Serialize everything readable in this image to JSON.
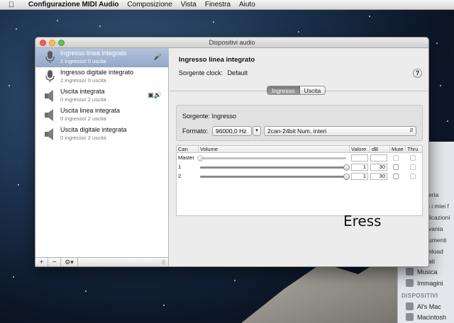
{
  "menubar": {
    "app_name": "Configurazione MIDI Audio",
    "items": [
      "Composizione",
      "Vista",
      "Finestra",
      "Aiuto"
    ],
    "apple_icon": "apple-logo-icon"
  },
  "finder_sidebar": {
    "partial_items": [
      "eria",
      "i i miei f",
      "licazioni",
      "vania",
      "umenti",
      "nload",
      "ati"
    ],
    "items": [
      {
        "label": "Musica",
        "icon": "music-icon"
      },
      {
        "label": "Immagini",
        "icon": "camera-icon"
      }
    ],
    "section_header": "DISPOSITIVI",
    "devices": [
      {
        "label": "Al's Mac",
        "icon": "computer-icon"
      },
      {
        "label": "Macintosh",
        "icon": "drive-icon"
      }
    ]
  },
  "window": {
    "title": "Dispositivi audio"
  },
  "devices": [
    {
      "name": "Ingresso linea integrato",
      "channels": "2 ingresso/ 0 uscita",
      "icon": "microphone-icon",
      "selected": true,
      "right_icon": "microphone-small-icon"
    },
    {
      "name": "Ingresso digitale integrato",
      "channels": "2 ingresso/ 0 uscita",
      "icon": "microphone-icon",
      "selected": false
    },
    {
      "name": "Uscita integrata",
      "channels": "0 ingresso/ 2 uscita",
      "icon": "speaker-icon",
      "selected": false,
      "right_icon": "finder-speaker-icon"
    },
    {
      "name": "Uscita linea integrata",
      "channels": "0 ingresso/ 2 uscita",
      "icon": "speaker-icon",
      "selected": false
    },
    {
      "name": "Uscita digitale integrata",
      "channels": "0 ingresso/ 2 uscita",
      "icon": "speaker-icon",
      "selected": false
    }
  ],
  "toolbar": {
    "add_label": "+",
    "remove_label": "−",
    "gear_label": "⚙▾"
  },
  "detail": {
    "device_title": "Ingresso linea integrato",
    "clock_label": "Sorgente clock:",
    "clock_value": "Default",
    "help_label": "?",
    "tabs": [
      {
        "label": "Ingresso",
        "active": true
      },
      {
        "label": "Uscita",
        "active": false
      }
    ],
    "source_label": "Sorgente:",
    "source_value": "Ingresso",
    "format_label": "Formato:",
    "sample_rate": "96000,0 Hz",
    "bit_format": "2can-24bit Num. interi"
  },
  "volume_table": {
    "headers": [
      "Can",
      "Volume",
      "Valore",
      "dB",
      "Mute",
      "Thru"
    ],
    "rows": [
      {
        "channel": "Master",
        "level": 0.0,
        "value": "",
        "db": "",
        "enabled": false
      },
      {
        "channel": "1",
        "level": 1.0,
        "value": "1",
        "db": "30",
        "enabled": true
      },
      {
        "channel": "2",
        "level": 1.0,
        "value": "1",
        "db": "30",
        "enabled": true
      }
    ]
  },
  "overlay_text": "Eress"
}
